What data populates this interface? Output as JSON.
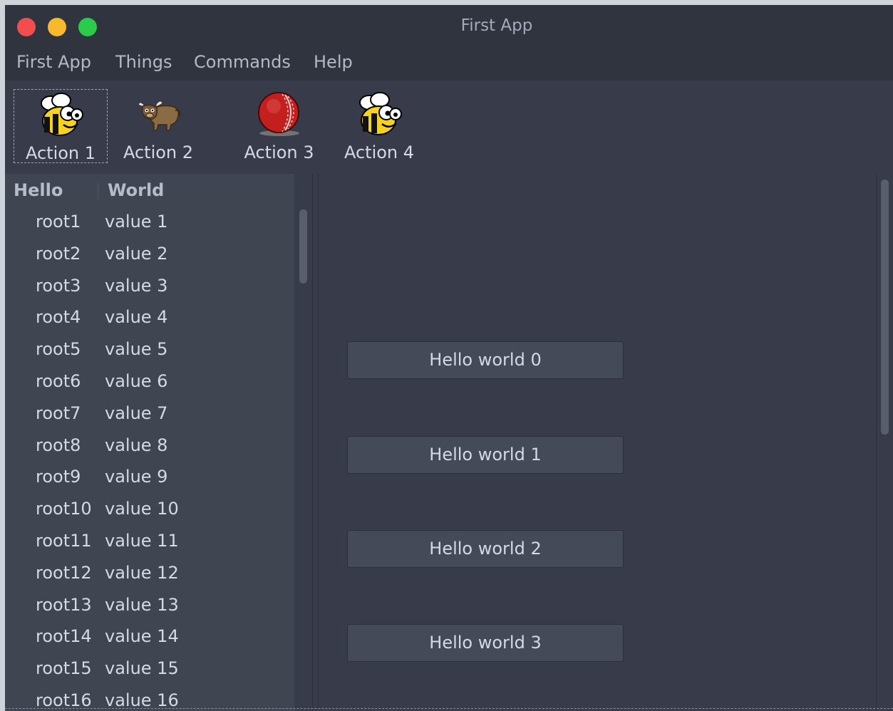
{
  "window": {
    "title": "First App"
  },
  "menubar": {
    "items": [
      "First App",
      "Things",
      "Commands",
      "Help"
    ]
  },
  "toolbar": {
    "actions": [
      {
        "label": "Action 1",
        "icon": "bee-icon"
      },
      {
        "label": "Action 2",
        "icon": "yak-icon"
      },
      {
        "label": "Action 3",
        "icon": "cricket-ball-icon"
      },
      {
        "label": "Action 4",
        "icon": "bee-icon"
      }
    ]
  },
  "tree": {
    "columns": [
      "Hello",
      "World"
    ],
    "rows": [
      [
        "root1",
        "value 1"
      ],
      [
        "root2",
        "value 2"
      ],
      [
        "root3",
        "value 3"
      ],
      [
        "root4",
        "value 4"
      ],
      [
        "root5",
        "value 5"
      ],
      [
        "root6",
        "value 6"
      ],
      [
        "root7",
        "value 7"
      ],
      [
        "root8",
        "value 8"
      ],
      [
        "root9",
        "value 9"
      ],
      [
        "root10",
        "value 10"
      ],
      [
        "root11",
        "value 11"
      ],
      [
        "root12",
        "value 12"
      ],
      [
        "root13",
        "value 13"
      ],
      [
        "root14",
        "value 14"
      ],
      [
        "root15",
        "value 15"
      ],
      [
        "root16",
        "value 16"
      ]
    ]
  },
  "main": {
    "buttons": [
      "Hello world 0",
      "Hello world 1",
      "Hello world 2",
      "Hello world 3"
    ]
  },
  "colors": {
    "background": "#383c4a",
    "titlebar": "#2f343f",
    "close": "#f44d4f",
    "minimize": "#f9b92d",
    "maximize": "#2bcb4b"
  }
}
